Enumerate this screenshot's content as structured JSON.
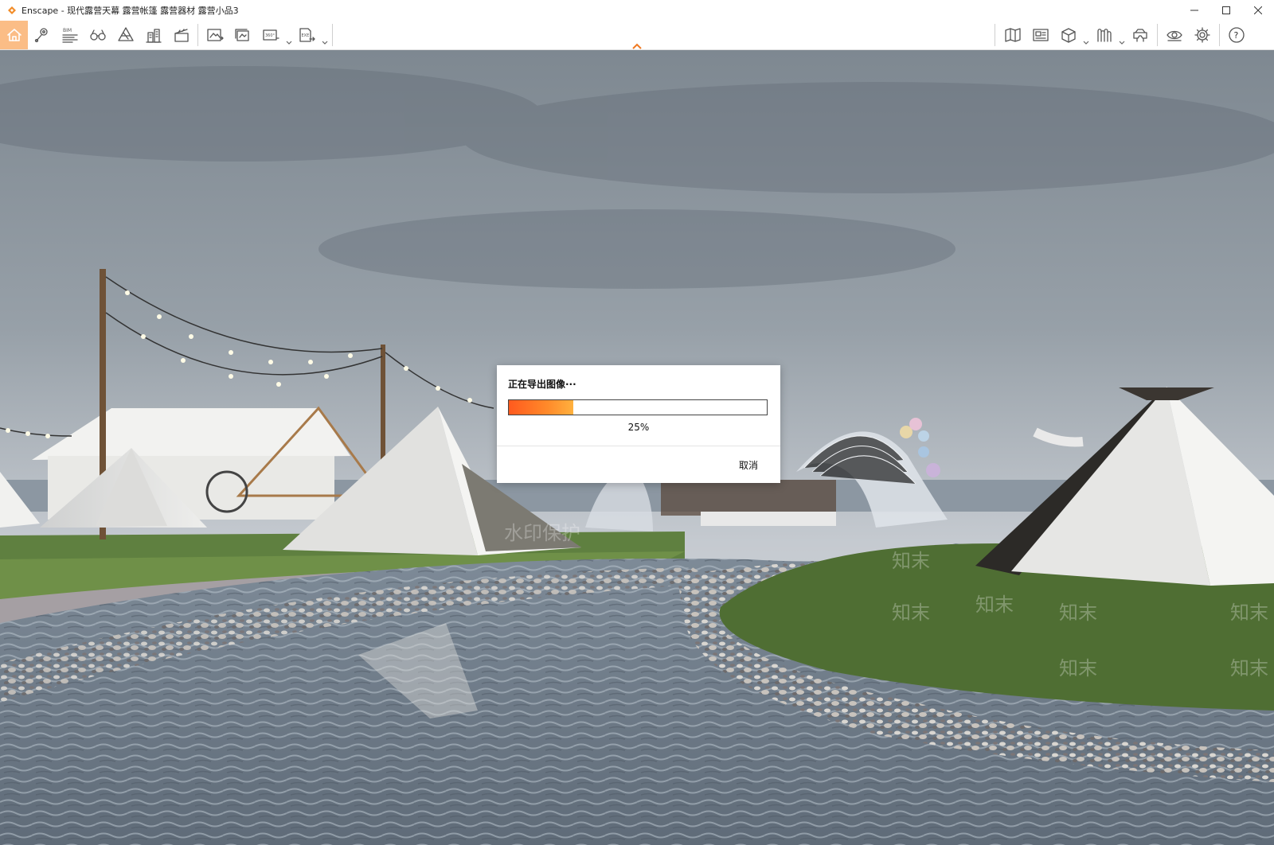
{
  "window": {
    "title": "Enscape - 现代露营天幕 露营帐篷 露营器材 露营小品3"
  },
  "window_controls": [
    "minimize",
    "maximize",
    "close"
  ],
  "toolbar": {
    "left_tools": [
      {
        "icon": "home-icon",
        "active": true
      },
      {
        "icon": "map-pin-icon"
      },
      {
        "icon": "bim-icon",
        "label": "BIM"
      },
      {
        "icon": "binoculars-icon"
      },
      {
        "icon": "material-icon"
      },
      {
        "icon": "buildings-icon"
      },
      {
        "icon": "clapperboard-icon"
      },
      {
        "icon": "screenshot-icon"
      },
      {
        "icon": "batch-render-icon"
      },
      {
        "icon": "panorama-360-icon",
        "label": "360°",
        "dropdown": true
      },
      {
        "icon": "export-exe-icon",
        "label": "EXE",
        "dropdown": true
      }
    ],
    "right_tools": [
      {
        "icon": "map-icon"
      },
      {
        "icon": "asset-library-icon"
      },
      {
        "icon": "cube-icon",
        "dropdown": true
      },
      {
        "icon": "visual-settings-icon",
        "dropdown": true
      },
      {
        "icon": "vr-headset-icon"
      },
      {
        "icon": "eye-icon"
      },
      {
        "icon": "gear-icon"
      },
      {
        "icon": "help-icon",
        "label": "?"
      }
    ],
    "accent_color": "#fbbd86",
    "collapse_color": "#f07a23"
  },
  "viewport": {
    "watermarks": [
      "水印保护",
      "知末",
      "知末",
      "知末",
      "知末",
      "知末",
      "知末",
      "知末"
    ]
  },
  "dialog": {
    "title": "正在导出图像···",
    "progress": 0.25,
    "progress_label": "25%",
    "cancel_label": "取消",
    "progress_colors": [
      "#ff5a1e",
      "#ffb13e"
    ]
  }
}
